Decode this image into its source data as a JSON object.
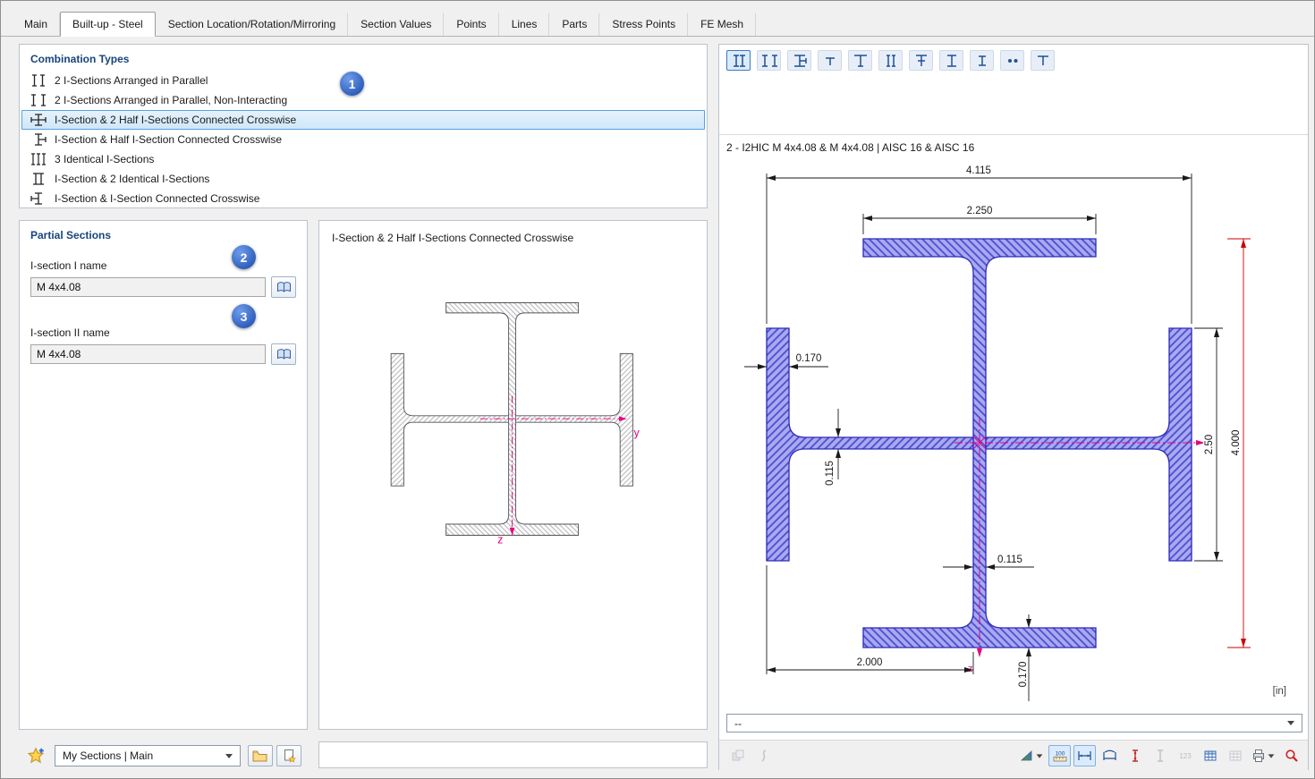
{
  "tabs": {
    "active": "Built-up - Steel",
    "items": [
      {
        "label": "Main"
      },
      {
        "label": "Built-up - Steel"
      },
      {
        "label": "Section Location/Rotation/Mirroring"
      },
      {
        "label": "Section Values"
      },
      {
        "label": "Points"
      },
      {
        "label": "Lines"
      },
      {
        "label": "Parts"
      },
      {
        "label": "Stress Points"
      },
      {
        "label": "FE Mesh"
      }
    ]
  },
  "combination_types": {
    "title": "Combination Types",
    "items": [
      {
        "label": "2 I-Sections Arranged in Parallel",
        "icon": "two-i-parallel"
      },
      {
        "label": "2 I-Sections Arranged in Parallel, Non-Interacting",
        "icon": "two-i-parallel-noninteracting"
      },
      {
        "label": "I-Section & 2 Half I-Sections Connected Crosswise",
        "icon": "i-2half-crosswise",
        "selected": true
      },
      {
        "label": "I-Section & Half I-Section Connected Crosswise",
        "icon": "i-half-crosswise"
      },
      {
        "label": "3 Identical I-Sections",
        "icon": "three-identical-i"
      },
      {
        "label": "I-Section & 2 Identical I-Sections",
        "icon": "i-2identical-i"
      },
      {
        "label": "I-Section & I-Section Connected Crosswise",
        "icon": "i-i-crosswise"
      }
    ]
  },
  "callouts": {
    "step1": "1",
    "step2": "2",
    "step3": "3"
  },
  "partial_sections": {
    "title": "Partial Sections",
    "section1": {
      "label": "I-section I name",
      "value": "M 4x4.08"
    },
    "section2": {
      "label": "I-section II name",
      "value": "M 4x4.08"
    }
  },
  "preview": {
    "title": "I-Section & 2 Half I-Sections Connected Crosswise",
    "axis_y_label": "y",
    "axis_z_label": "z"
  },
  "favorites_bar": {
    "dropdown_value": "My Sections | Main"
  },
  "right_panel": {
    "section_title": "2 - I2HIC M 4x4.08 & M 4x4.08 | AISC 16 & AISC 16",
    "dimensions": {
      "overall_width": "4.115",
      "top_flange_width": "2.250",
      "left_flange_thickness": "0.170",
      "left_web_thickness": "0.115",
      "right_half_height": "2.50",
      "overall_height": "4.000",
      "center_web_thickness": "0.115",
      "bottom_left_width": "2.000",
      "bottom_flange_thickness": "0.170"
    },
    "unit_label": "[in]",
    "axis_z_label": "z",
    "result_dropdown_value": "--",
    "toolbar": {
      "ruler_label": "100",
      "numbering_label": "123"
    },
    "shape_toolbar_icons": [
      "two-i-parallel",
      "two-i-parallel-noninteracting",
      "i-2half-crosswise",
      "half-t-section",
      "t-section",
      "two-i-narrow",
      "i-half-cross",
      "i-section",
      "i-section-narrow",
      "two-round-bars",
      "t-section-short"
    ]
  },
  "colors": {
    "accent": "#2f6fc4",
    "selection_bg": "#cfe7fa",
    "selection_border": "#58a0e2",
    "section_fill": "#a9a9ef",
    "section_hatch": "#4d4dd2",
    "section_outline": "#2a2ab8",
    "dimension": "#1a1a1a",
    "dimension_red": "#cc0000",
    "axis_magenta": "#e6007e",
    "badge_blue": "#2d5cba",
    "header_blue": "#17457c"
  }
}
